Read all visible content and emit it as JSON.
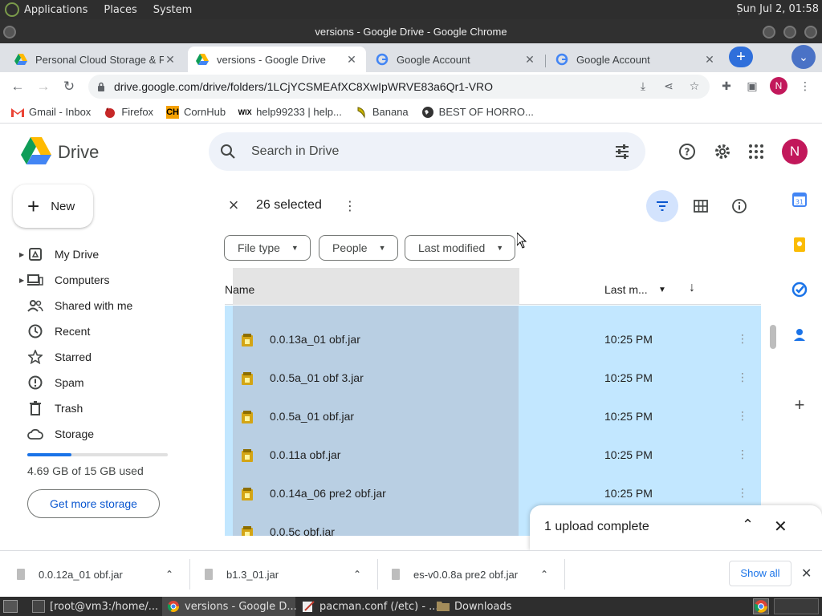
{
  "os": {
    "menus": [
      "Applications",
      "Places",
      "System"
    ],
    "clock": "Sun Jul  2, 01:58"
  },
  "window": {
    "title": "versions - Google Drive - Google Chrome"
  },
  "tabs": [
    {
      "label": "Personal Cloud Storage & F",
      "icon": "drive-icon"
    },
    {
      "label": "versions - Google Drive",
      "icon": "drive-icon"
    },
    {
      "label": "Google Account",
      "icon": "google-icon"
    },
    {
      "label": "Google Account",
      "icon": "google-icon"
    }
  ],
  "address": {
    "url": "drive.google.com/drive/folders/1LCjYCSMEAfXC8XwIpWRVE83a6Qr1-VRO"
  },
  "profile_initial": "N",
  "bookmarks": [
    {
      "label": "Gmail - Inbox",
      "icon": "gmail-icon"
    },
    {
      "label": "Firefox",
      "icon": "firefox-icon"
    },
    {
      "label": "CornHub",
      "icon": "ch-icon"
    },
    {
      "label": "help99233 | help...",
      "icon": "wix-icon"
    },
    {
      "label": "Banana",
      "icon": "banana-icon"
    },
    {
      "label": "BEST OF HORRO...",
      "icon": "globe-icon"
    }
  ],
  "drive": {
    "name": "Drive",
    "search_placeholder": "Search in Drive",
    "avatar_initial": "N"
  },
  "sidebar": {
    "new_label": "New",
    "items": [
      {
        "label": "My Drive",
        "icon": "my-drive-icon",
        "expandable": true
      },
      {
        "label": "Computers",
        "icon": "computers-icon",
        "expandable": true
      },
      {
        "label": "Shared with me",
        "icon": "shared-icon",
        "expandable": false
      },
      {
        "label": "Recent",
        "icon": "clock-icon",
        "expandable": false
      },
      {
        "label": "Starred",
        "icon": "star-icon",
        "expandable": false
      },
      {
        "label": "Spam",
        "icon": "spam-icon",
        "expandable": false
      },
      {
        "label": "Trash",
        "icon": "trash-icon",
        "expandable": false
      },
      {
        "label": "Storage",
        "icon": "cloud-icon",
        "expandable": false
      }
    ],
    "storage_text": "4.69 GB of 15 GB used",
    "storage_fraction": 0.313,
    "get_storage_label": "Get more storage"
  },
  "selection": {
    "count_label": "26 selected"
  },
  "filters": [
    "File type",
    "People",
    "Last modified"
  ],
  "table": {
    "name_header": "Name",
    "modified_header": "Last m...",
    "rows": [
      {
        "name": "0.0.13a_01 obf.jar",
        "modified": "10:25 PM"
      },
      {
        "name": "0.0.5a_01 obf 3.jar",
        "modified": "10:25 PM"
      },
      {
        "name": "0.0.5a_01 obf.jar",
        "modified": "10:25 PM"
      },
      {
        "name": "0.0.11a obf.jar",
        "modified": "10:25 PM"
      },
      {
        "name": "0.0.14a_06 pre2 obf.jar",
        "modified": "10:25 PM"
      },
      {
        "name": "0.0.5c obf.jar",
        "modified": ""
      }
    ]
  },
  "upload": {
    "status": "1 upload complete"
  },
  "downloads": {
    "items": [
      "0.0.12a_01 obf.jar",
      "b1.3_01.jar",
      "es-v0.0.8a pre2 obf.jar"
    ],
    "show_all_label": "Show all"
  },
  "taskbar": [
    {
      "label": "[root@vm3:/home/...",
      "icon": "terminal-icon"
    },
    {
      "label": "versions - Google D...",
      "icon": "chrome-icon"
    },
    {
      "label": "pacman.conf (/etc) - ...",
      "icon": "editor-icon"
    },
    {
      "label": "Downloads",
      "icon": "folder-icon"
    }
  ],
  "colors": {
    "selection_bg": "#c2e7ff",
    "accent": "#0b57d0",
    "avatar": "#c2185b"
  }
}
